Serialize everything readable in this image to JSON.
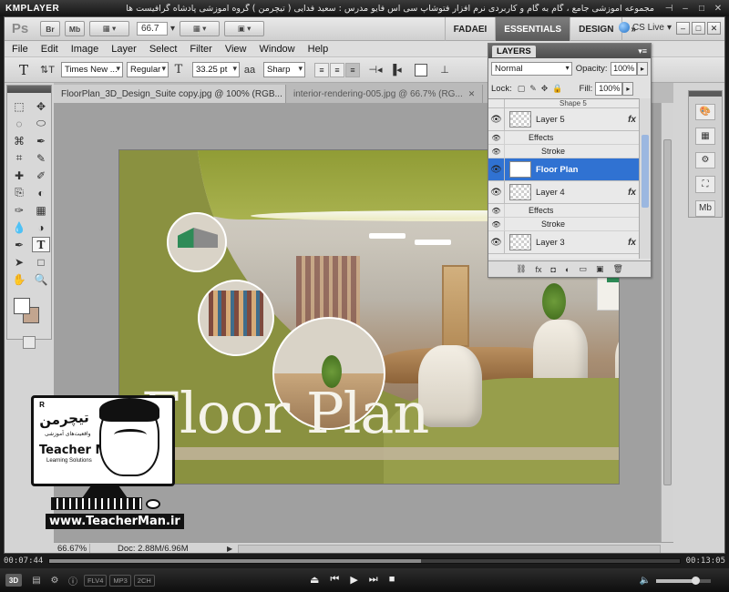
{
  "player": {
    "logo": "KMPLAYER",
    "caption": "مجموعه آموزشی جامع ، گام به گام و کاربردی نرم افزار فتوشاپ سی اس فایو   مدرس : سعید فدایی ( تیچرمن ) گروه آموزشی پادشاه گرافیست ها",
    "pin": "⊣",
    "minimize": "–",
    "maximize": "□",
    "close": "✕",
    "time_elapsed": "00:07:44",
    "time_total": "00:13:05",
    "progress": 0.59,
    "volume": 0.72,
    "btn_3d": "3D",
    "codecs": [
      "FLV4",
      "MP3",
      "2CH"
    ],
    "transport": [
      "⏏",
      "⏮",
      "▶",
      "⏭",
      "■"
    ],
    "volume_icon": "🔈"
  },
  "ps": {
    "logo": "Ps",
    "app_buttons": [
      "Br",
      "Mb"
    ],
    "zoom": "66.7",
    "workspaces": [
      "FADAEI",
      "ESSENTIALS",
      "DESIGN"
    ],
    "active_workspace": "ESSENTIALS",
    "workspace_more": "»",
    "cs_live": "CS Live",
    "win_buttons": [
      "–",
      "□",
      "✕"
    ],
    "menu": [
      "File",
      "Edit",
      "Image",
      "Layer",
      "Select",
      "Filter",
      "View",
      "Window",
      "Help"
    ]
  },
  "options": {
    "tool_glyph": "T",
    "orient_glyph": "⇅T",
    "font_family": "Times New ...",
    "font_style": "Regular",
    "size_glyph": "T",
    "font_size": "33.25 pt",
    "aa_glyph": "aa",
    "antialias": "Sharp",
    "align": [
      "≡",
      "≡",
      "≡"
    ],
    "warp_glyph": "⊥",
    "cancel_glyph": "⊘"
  },
  "tools": [
    "⬚",
    "✥",
    "◌",
    "⬭",
    "⌘",
    "✒",
    "⌗",
    "✎",
    "✚",
    "✐",
    "⎘",
    "◐",
    "✑",
    "▦",
    "💧",
    "◑",
    "✒",
    "T",
    "➤",
    "□",
    "✋",
    "🔍"
  ],
  "active_tool_index": 17,
  "document": {
    "tabs": [
      {
        "label": "FloorPlan_3D_Design_Suite copy.jpg @ 100% (RGB...",
        "close": "✕"
      },
      {
        "label": "interior-rendering-005.jpg @ 66.7% (RG...",
        "close": "✕"
      }
    ],
    "canvas_text": "Floor Plan",
    "zoom_status": "66.67%",
    "doc_size": "Doc: 2.88M/6.96M",
    "status_arrow": "▶"
  },
  "layers": {
    "tab": "LAYERS",
    "menu_glyph": "▾≡",
    "blend_mode": "Normal",
    "opacity_label": "Opacity:",
    "opacity": "100%",
    "fill_label": "Fill:",
    "fill": "100%",
    "lock_label": "Lock:",
    "lock_icons": [
      "▢",
      "✎",
      "✥",
      "🔒"
    ],
    "top_partial": "Shape 5",
    "rows": [
      {
        "name": "Layer 5",
        "kind": "layer",
        "fx": "fx"
      },
      {
        "name": "Effects",
        "kind": "effects"
      },
      {
        "name": "Stroke",
        "kind": "effect"
      },
      {
        "name": "Floor Plan",
        "kind": "text",
        "selected": true
      },
      {
        "name": "Layer 4",
        "kind": "layer",
        "fx": "fx"
      },
      {
        "name": "Effects",
        "kind": "effects"
      },
      {
        "name": "Stroke",
        "kind": "effect"
      },
      {
        "name": "Layer 3",
        "kind": "layer",
        "fx": "fx"
      }
    ],
    "footer": [
      "⛓",
      "fx",
      "◘",
      "◐",
      "▭",
      "▣",
      "🗑"
    ]
  },
  "dock": [
    "🎨",
    "▦",
    "⚙",
    "⛶",
    "Mb"
  ],
  "overlay": {
    "persian_brand": "تیچرمن",
    "persian_sub": "واقعیت‌های آموزشی",
    "brand": "Teacher Man",
    "tagline": "Learning Solutions",
    "url": "www.TeacherMan.ir",
    "registered": "R"
  }
}
